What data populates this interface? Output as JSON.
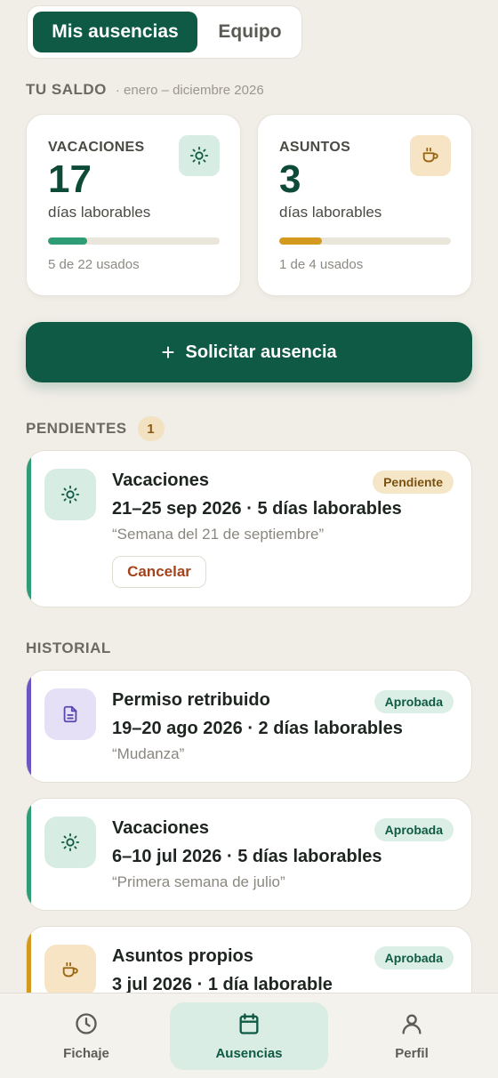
{
  "tabs": {
    "mine": "Mis ausencias",
    "team": "Equipo",
    "active": "mine"
  },
  "balance": {
    "label": "TU SALDO",
    "range": "· enero – diciembre 2026",
    "cards": [
      {
        "title": "VACACIONES",
        "days": "17",
        "unit": "días laborables",
        "used_text": "5 de 22 usados",
        "used_fraction": 0.227,
        "color": "#2e9c74",
        "icon": "sun-icon"
      },
      {
        "title": "ASUNTOS",
        "days": "3",
        "unit": "días laborables",
        "used_text": "1 de 4 usados",
        "used_fraction": 0.25,
        "color": "#d49a1f",
        "icon": "coffee-icon"
      }
    ]
  },
  "cta": {
    "label": "Solicitar ausencia"
  },
  "pending": {
    "label": "PENDIENTES",
    "count": "1",
    "items": [
      {
        "type": "Vacaciones",
        "dates": "21–25 sep 2026 · 5 días laborables",
        "note": "“Semana del 21 de septiembre”",
        "status": "Pendiente",
        "cancel_label": "Cancelar",
        "icon": "sun-icon",
        "accent": "#2e9c74"
      }
    ]
  },
  "history": {
    "label": "HISTORIAL",
    "items": [
      {
        "type": "Permiso retribuido",
        "dates": "19–20 ago 2026 · 2 días laborables",
        "note": "“Mudanza”",
        "status": "Aprobada",
        "icon": "document-icon",
        "accent": "#6a55c2"
      },
      {
        "type": "Vacaciones",
        "dates": "6–10 jul 2026 · 5 días laborables",
        "note": "“Primera semana de julio”",
        "status": "Aprobada",
        "icon": "sun-icon",
        "accent": "#2e9c74"
      },
      {
        "type": "Asuntos propios",
        "dates": "3 jul 2026 · 1 día laborable",
        "note": "",
        "status": "Aprobada",
        "icon": "coffee-icon",
        "accent": "#d49a1f"
      }
    ]
  },
  "nav": [
    {
      "label": "Fichaje",
      "icon": "clock-icon"
    },
    {
      "label": "Ausencias",
      "icon": "calendar-icon",
      "active": true
    },
    {
      "label": "Perfil",
      "icon": "user-icon"
    }
  ]
}
